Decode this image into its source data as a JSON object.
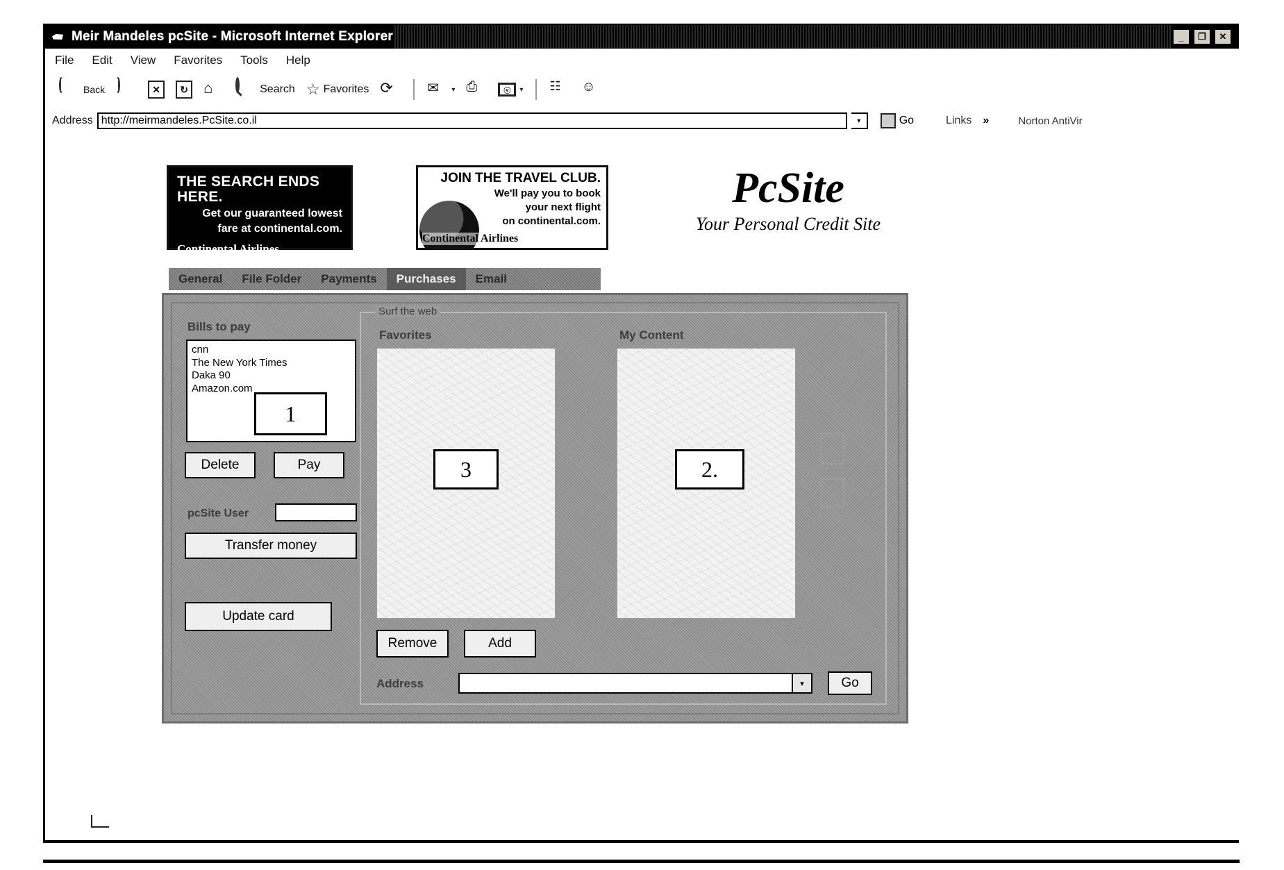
{
  "window": {
    "title": "Meir Mandeles pcSite - Microsoft Internet Explorer",
    "minimize_label": "_",
    "maximize_label": "❐",
    "close_label": "✕"
  },
  "menubar": {
    "items": [
      "File",
      "Edit",
      "View",
      "Favorites",
      "Tools",
      "Help"
    ]
  },
  "toolbar": {
    "back": "Back",
    "forward": "Forward",
    "stop": "✕",
    "refresh": "↻",
    "home": "⌂",
    "search": "Search",
    "favorites": "Favorites",
    "history": "⟳",
    "mail": "✉",
    "print": "⎙",
    "edit": "ⓥ",
    "caret": "▾",
    "discuss": "☷",
    "messenger": "☺"
  },
  "address": {
    "label": "Address",
    "url": "http://meirmandeles.PcSite.co.il",
    "dropdown_arrow": "▾",
    "go_label": "Go",
    "links_label": "Links",
    "chevron": "»",
    "antivirus_label": "Norton AntiVir"
  },
  "banners": [
    {
      "name": "continental-search-banner",
      "line1": "THE SEARCH ENDS HERE.",
      "line2": "Get our guaranteed lowest",
      "line3": "fare at continental.com.",
      "brand": "Continental Airlines"
    },
    {
      "name": "continental-travel-club-banner",
      "line1": "JOIN THE TRAVEL CLUB.",
      "line2": "We'll pay you to book",
      "line3": "your next flight",
      "line4": "on continental.com.",
      "brand": "Continental Airlines"
    }
  ],
  "site": {
    "logo": "PcSite",
    "tagline": "Your Personal Credit Site"
  },
  "tabs": [
    {
      "label": "General",
      "selected": false
    },
    {
      "label": "File Folder",
      "selected": false
    },
    {
      "label": "Payments",
      "selected": false
    },
    {
      "label": "Purchases",
      "selected": true
    },
    {
      "label": "Email",
      "selected": false
    }
  ],
  "purchases": {
    "bills": {
      "label": "Bills to pay",
      "items": [
        "cnn",
        "The New York Times",
        "Daka 90",
        "Amazon.com"
      ],
      "delete_label": "Delete",
      "pay_label": "Pay",
      "annotation": "1"
    },
    "transfer": {
      "user_label": "pcSite User",
      "user_value": "",
      "transfer_label": "Transfer money",
      "update_card_label": "Update card"
    },
    "surf": {
      "legend": "Surf the web",
      "favorites_label": "Favorites",
      "favorites_annotation": "3",
      "content_label": "My Content",
      "content_annotation": "2.",
      "remove_label": "Remove",
      "add_label": "Add",
      "address_label": "Address",
      "address_value": "",
      "address_arrow": "▾",
      "go_label": "Go"
    }
  }
}
